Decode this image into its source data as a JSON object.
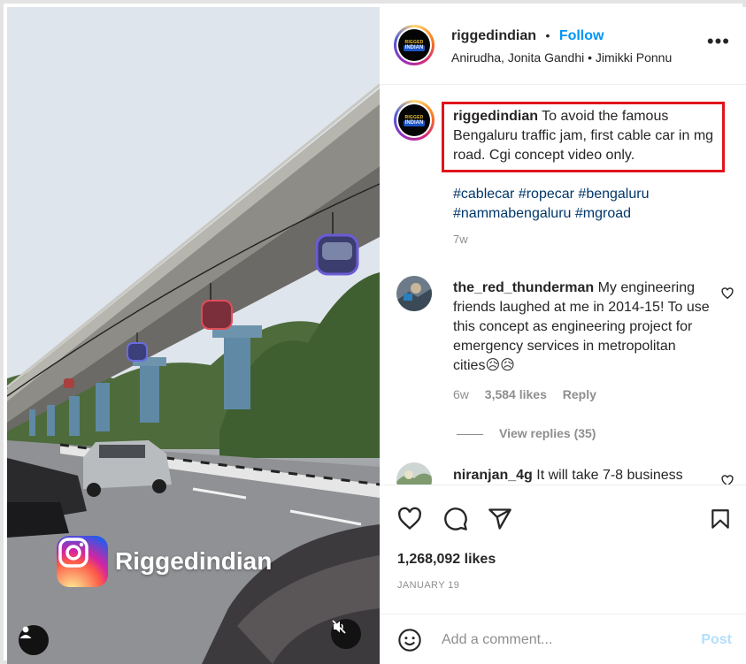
{
  "post": {
    "username": "riggedindian",
    "follow_label": "Follow",
    "separator": "•",
    "subline": "Anirudha, Jonita Gandhi • Jimikki Ponnu",
    "avatar_line1": "RIGGED",
    "avatar_line2": "INDIAN",
    "more_label": "•••",
    "caption_text": "To avoid the famous Bengaluru traffic jam, first cable car in mg road. Cgi concept video only.",
    "hashtags": "#cablecar #ropecar #bengaluru #nammabengaluru #mgroad",
    "time": "7w",
    "likes": "1,268,092 likes",
    "date": "JANUARY 19",
    "watermark": "Riggedindian"
  },
  "comments": [
    {
      "username": "the_red_thunderman",
      "text": "My engineering friends laughed at me in 2014-15! To use this concept as engineering project for emergency services in metropolitan cities😥😥",
      "time": "6w",
      "likes": "3,584 likes",
      "reply_label": "Reply",
      "view_replies": "View replies (35)"
    },
    {
      "username": "niranjan_4g",
      "text": "It will take 7-8 business"
    }
  ],
  "add_comment": {
    "placeholder": "Add a comment...",
    "post_label": "Post"
  },
  "icons": {
    "like": "heart-icon",
    "comment": "comment-icon",
    "share": "paper-plane-icon",
    "save": "bookmark-icon",
    "emoji": "smiley-icon",
    "user": "user-tag-icon",
    "mute": "speaker-muted-icon"
  }
}
